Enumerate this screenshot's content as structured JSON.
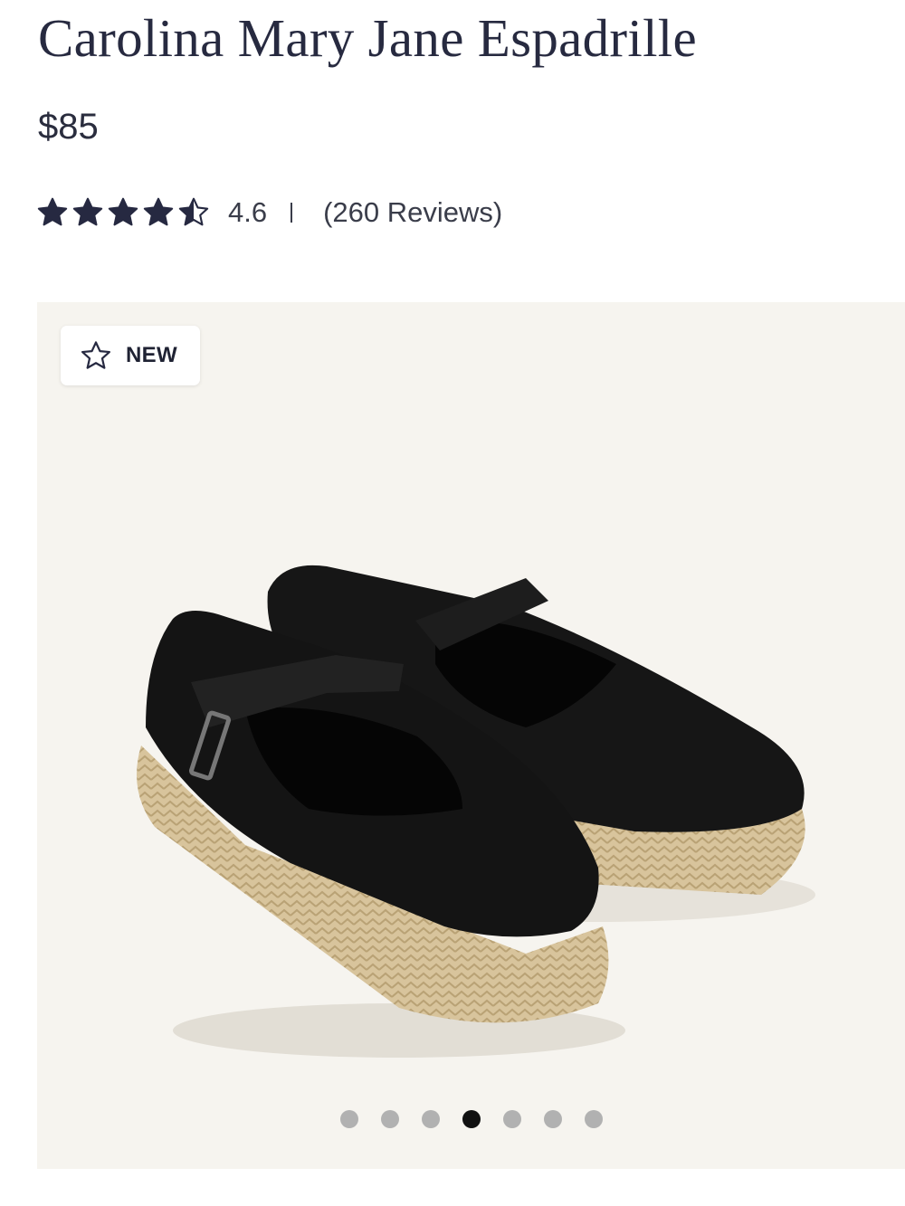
{
  "product": {
    "title": "Carolina Mary Jane Espadrille",
    "price": "$85",
    "rating": {
      "stars": 4.5,
      "value": "4.6",
      "reviews": "(260 Reviews)"
    }
  },
  "gallery": {
    "badge_label": "NEW",
    "image_icon": "black-mary-jane-espadrille-pair",
    "total_images": 7,
    "active_index": 3
  },
  "colors": {
    "title": "#272a40",
    "star": "#262941",
    "gallery_bg": "#f6f4ef",
    "dot_inactive": "#b1b1b1",
    "dot_active": "#111111"
  }
}
